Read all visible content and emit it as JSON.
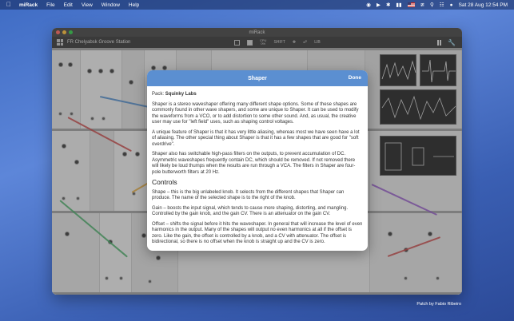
{
  "menubar": {
    "app_name": "miRack",
    "items": [
      "File",
      "Edit",
      "View",
      "Window",
      "Help"
    ],
    "date_time": "Sat 28 Aug  12:54 PM"
  },
  "window": {
    "title": "miRack",
    "patch_name": "FR Chelyabsk Groove Station",
    "cpu_label": "CPU",
    "cpu_value": "0%",
    "shift_label": "SHIFT",
    "lib_label": "LIB"
  },
  "sheet": {
    "title": "Shaper",
    "done_label": "Done",
    "pack_prefix": "Pack: ",
    "pack_name": "Squinky Labs",
    "intro_1": "Shaper is a stereo waveshaper offering many different shape options. Some of these shapes are commonly found in other wave shapers, and some are unique to Shaper. It can be used to modify the waveforms from a VCO, or to add distortion to some other sound. And, as usual, the creative user may use for \"left field\" uses, such as shaping control voltages.",
    "intro_2": "A unique feature of Shaper is that it has very little aliasing, whereas most we have seen have a lot of aliasing. The other special thing about Shaper is that it has a few shapes that are good for \"soft overdrive\".",
    "intro_3": "Shaper also has switchable high-pass filters on the outputs, to prevent accumulation of DC. Asymmetric waveshapes frequently contain DC, which should be removed. If not removed there will likely be loud thumps when the results are run through a VCA. The filters in Shaper are four-pole butterworth filters at 20 Hz.",
    "controls_heading": "Controls",
    "control_shape": "Shape – this is the big unlabeled knob. It selects from the different shapes that Shaper can produce. The name of the selected shape is to the right of the knob.",
    "control_gain": "Gain – boosts the input signal, which tends to cause more shaping, distorting, and mangling. Controlled by the gain knob, and the gain CV. There is an attenuator on the gain CV.",
    "control_offset": "Offset – shifts the signal before it hits the waveshaper. In general that will increase the level of even harmonics in the output. Many of the shapes will output no even harmonics at all if the offset is zero. Like the gain, the offset is controlled by a knob, and a CV with attenuator. The offset is bidirectional, so there is no offset when the knob is straight up and the CV is zero."
  },
  "caption": "Patch by Fabio Ribeiro"
}
